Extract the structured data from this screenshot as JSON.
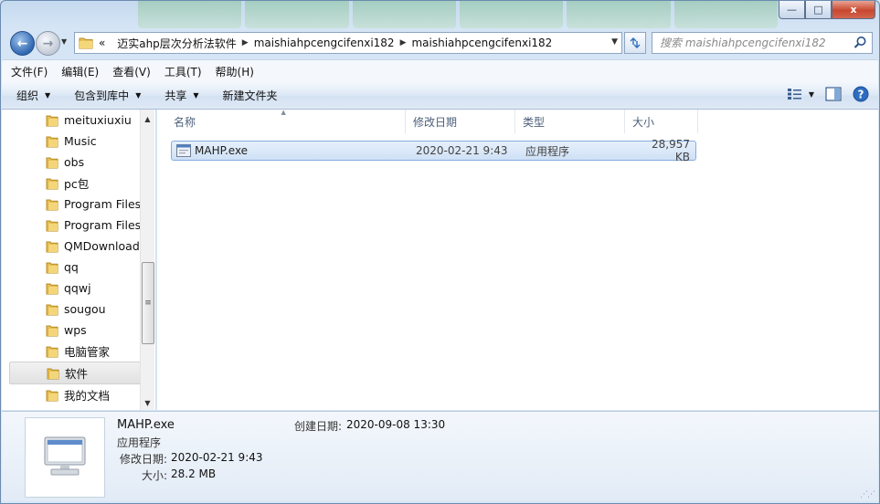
{
  "window": {
    "buttons": {
      "minimize": "—",
      "maximize": "□",
      "close": "x"
    }
  },
  "address": {
    "back_glyph": "←",
    "forward_glyph": "→",
    "overflow": "«",
    "crumbs": [
      "迈实ahp层次分析法软件",
      "maishiahpcengcifenxi182",
      "maishiahpcengcifenxi182"
    ],
    "search_placeholder": "搜索 maishiahpcengcifenxi182"
  },
  "menu": [
    "文件(F)",
    "编辑(E)",
    "查看(V)",
    "工具(T)",
    "帮助(H)"
  ],
  "toolbar": {
    "organize": "组织",
    "include_library": "包含到库中",
    "share": "共享",
    "new_folder": "新建文件夹"
  },
  "nav": {
    "items": [
      {
        "label": "meituxiuxiu"
      },
      {
        "label": "Music"
      },
      {
        "label": "obs"
      },
      {
        "label": "pc包"
      },
      {
        "label": "Program Files"
      },
      {
        "label": "Program Files"
      },
      {
        "label": "QMDownload"
      },
      {
        "label": "qq"
      },
      {
        "label": "qqwj"
      },
      {
        "label": "sougou"
      },
      {
        "label": "wps"
      },
      {
        "label": "电脑管家"
      },
      {
        "label": "软件",
        "selected": true
      },
      {
        "label": "我的文档"
      }
    ],
    "scroll_grip": "≡"
  },
  "columns": {
    "name": "名称",
    "modified": "修改日期",
    "type": "类型",
    "size": "大小"
  },
  "files": [
    {
      "name": "MAHP.exe",
      "modified": "2020-02-21 9:43",
      "type": "应用程序",
      "size": "28,957 KB",
      "selected": true
    }
  ],
  "details": {
    "name": "MAHP.exe",
    "type": "应用程序",
    "modified_label": "修改日期:",
    "modified_value": "2020-02-21 9:43",
    "size_label": "大小:",
    "size_value": "28.2 MB",
    "created_label": "创建日期:",
    "created_value": "2020-09-08 13:30"
  },
  "colors": {
    "accent": "#2f67b2",
    "selection": "#cfe1f6",
    "frame": "#d5e5f5"
  }
}
